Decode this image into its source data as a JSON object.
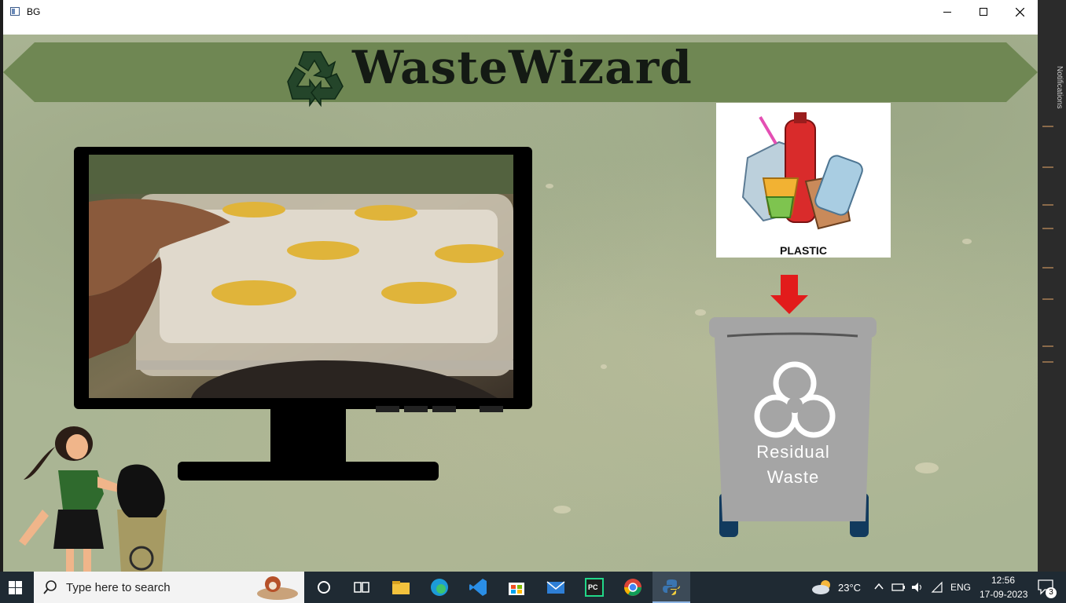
{
  "window": {
    "title": "BG"
  },
  "app": {
    "banner_title": "WasteWizard"
  },
  "prediction": {
    "category_label": "PLASTIC",
    "bin_label_line1": "Residual",
    "bin_label_line2": "Waste"
  },
  "taskbar": {
    "search_placeholder": "Type here to search",
    "weather": "23°C",
    "language": "ENG",
    "time": "12:56",
    "date": "17-09-2023",
    "notification_count": "3"
  },
  "side_panel": {
    "label": "Notifications"
  },
  "colors": {
    "banner": "#6f8753",
    "background": "#aab594",
    "bin": "#a5a5a5",
    "arrow": "#e21b1b"
  }
}
